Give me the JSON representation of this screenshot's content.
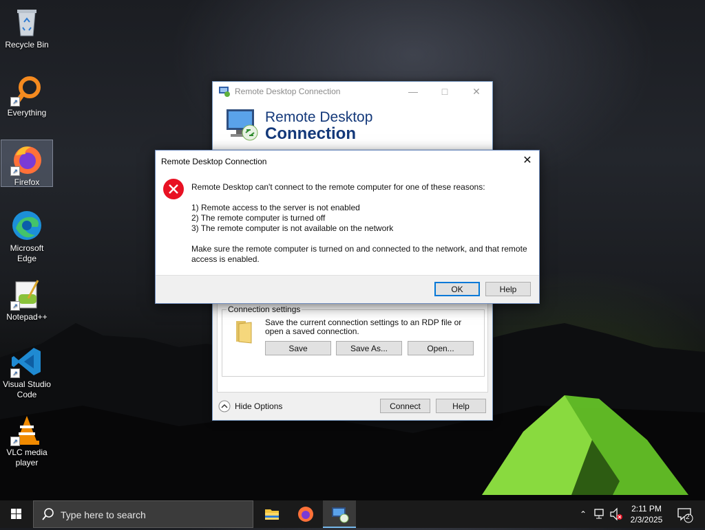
{
  "desktop": {
    "icons": [
      {
        "label": "Recycle Bin"
      },
      {
        "label": "Everything"
      },
      {
        "label": "Firefox"
      },
      {
        "label": "Microsoft Edge"
      },
      {
        "label": "Notepad++"
      },
      {
        "label": "Visual Studio Code"
      },
      {
        "label": "VLC media player"
      }
    ]
  },
  "main_window": {
    "title": "Remote Desktop Connection",
    "banner_line1": "Remote Desktop",
    "banner_line2": "Connection",
    "connection_settings": {
      "group_label": "Connection settings",
      "description": "Save the current connection settings to an RDP file or open a saved connection.",
      "save": "Save",
      "save_as": "Save As...",
      "open": "Open..."
    },
    "hide_options": "Hide Options",
    "connect": "Connect",
    "help": "Help"
  },
  "error_dialog": {
    "title": "Remote Desktop Connection",
    "message_intro": "Remote Desktop can't connect to the remote computer for one of these reasons:",
    "reasons": [
      "1) Remote access to the server is not enabled",
      "2) The remote computer is turned off",
      "3) The remote computer is not available on the network"
    ],
    "message_outro": "Make sure the remote computer is turned on and connected to the network, and that remote access is enabled.",
    "ok": "OK",
    "help": "Help"
  },
  "taskbar": {
    "search_placeholder": "Type here to search",
    "time": "2:11 PM",
    "date": "2/3/2025",
    "notification_count": "2"
  },
  "colors": {
    "accent": "#0078d7",
    "error_red": "#e81123",
    "banner_text": "#14397a"
  }
}
